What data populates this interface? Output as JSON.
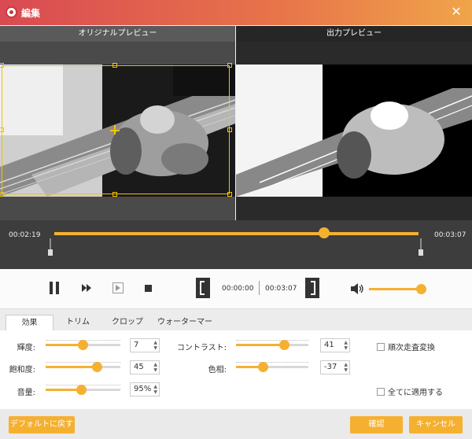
{
  "window": {
    "title": "編集",
    "close": "✕"
  },
  "preview": {
    "original_label": "オリジナルプレビュー",
    "output_label": "出力プレビュー"
  },
  "timeline": {
    "start_time": "00:02:19",
    "end_time": "00:03:07",
    "position": 0.74
  },
  "playback": {
    "current": "00:00:00",
    "total": "00:03:07",
    "volume": 0.92
  },
  "tabs": [
    {
      "label": "効果"
    },
    {
      "label": "トリム"
    },
    {
      "label": "クロップ"
    },
    {
      "label": "ウォーターマーク"
    }
  ],
  "effects": {
    "brightness": {
      "label": "輝度:",
      "value": "7",
      "level": 0.5
    },
    "saturation": {
      "label": "飽和度:",
      "value": "45",
      "level": 0.72
    },
    "volume": {
      "label": "音量:",
      "value": "95%",
      "level": 0.47
    },
    "contrast": {
      "label": "コントラスト:",
      "value": "41",
      "level": 0.7
    },
    "hue": {
      "label": "色相:",
      "value": "-37",
      "level": 0.35
    }
  },
  "options": {
    "deinterlace": "順次走査変換",
    "apply_all": "全てに適用する"
  },
  "buttons": {
    "reset": "デフォルトに戻す",
    "ok": "確認",
    "cancel": "キャンセル"
  },
  "colors": {
    "accent": "#f6b030",
    "title_start": "#d94a52",
    "title_end": "#f0a44a"
  }
}
